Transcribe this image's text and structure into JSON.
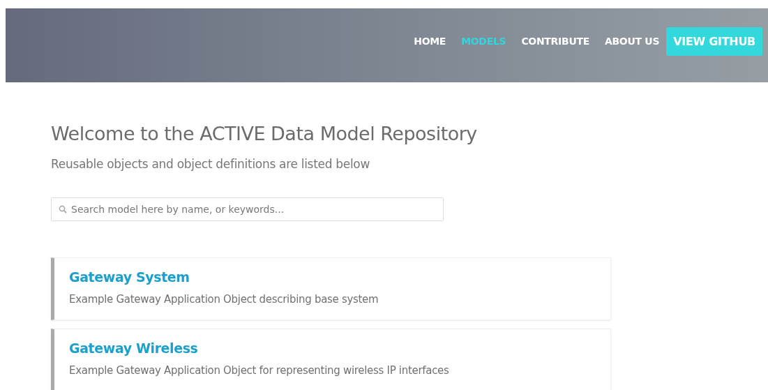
{
  "nav": {
    "items": [
      {
        "label": "HOME",
        "selected": false
      },
      {
        "label": "MODELS",
        "selected": true
      },
      {
        "label": "CONTRIBUTE",
        "selected": false
      },
      {
        "label": "ABOUT US",
        "selected": false
      }
    ],
    "button": "VIEW GITHUB"
  },
  "heading": "Welcome to the ACTIVE Data Model Repository",
  "subheading": "Reusable objects and object definitions are listed below",
  "search": {
    "placeholder": "Search model here by name, or keywords..."
  },
  "models": [
    {
      "title": "Gateway System",
      "description": "Example Gateway Application Object describing base system"
    },
    {
      "title": "Gateway Wireless",
      "description": "Example Gateway Application Object for representing wireless IP interfaces"
    }
  ]
}
